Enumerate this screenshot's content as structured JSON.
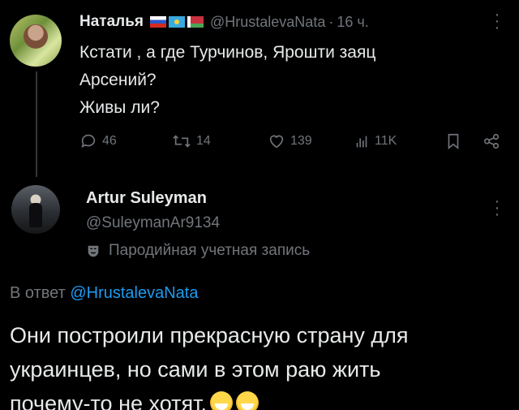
{
  "tweet1": {
    "author_name": "Наталья",
    "handle": "@HrustalevaNata",
    "separator": "·",
    "time": "16 ч.",
    "text_lines": [
      "Кстати , а где Турчинов, Ярошти заяц",
      "Арсений?",
      "Живы ли?"
    ],
    "flags": [
      "ru-flag-icon",
      "kz-flag-icon",
      "by-flag-icon"
    ],
    "more_icon": "more-vertical-icon",
    "actions": {
      "replies": "46",
      "retweets": "14",
      "likes": "139",
      "views": "11K"
    }
  },
  "tweet2": {
    "author_name": "Artur Suleyman",
    "handle": "@SuleymanAr9134",
    "parody_label": "Пародийная учетная запись",
    "reply_prefix": "В ответ",
    "reply_mention": "@HrustalevaNata",
    "text_lines": [
      "Они построили прекрасную страну для",
      "украинцев, но сами в этом раю жить",
      "почему-то не хотят."
    ],
    "emojis": [
      "sweat-smile-emoji",
      "sweat-smile-emoji"
    ]
  },
  "colors": {
    "background": "#000000",
    "text": "#e7e9ea",
    "muted": "#71767b",
    "link": "#1d9bf0"
  }
}
